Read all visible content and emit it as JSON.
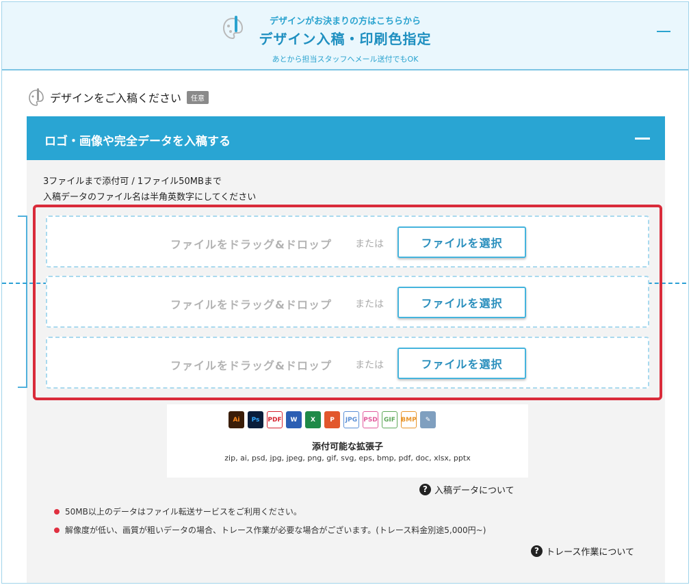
{
  "header": {
    "subtitle": "デザインがお決まりの方はこちらから",
    "title": "デザイン入稿・印刷色指定",
    "note": "あとから担当スタッフへメール送付でもOK",
    "icon": "palette-icon"
  },
  "section": {
    "title": "デザインをご入稿ください",
    "badge": "任意"
  },
  "panel": {
    "title": "ロゴ・画像や完全データを入稿する",
    "info_line1": "3ファイルまで添付可 / 1ファイル50MBまで",
    "info_line2": "入稿データのファイル名は半角英数字にしてください"
  },
  "dropzones": [
    {
      "drop_text": "ファイルをドラッグ&ドロップ",
      "or_text": "または",
      "button": "ファイルを選択"
    },
    {
      "drop_text": "ファイルをドラッグ&ドロップ",
      "or_text": "または",
      "button": "ファイルを選択"
    },
    {
      "drop_text": "ファイルをドラッグ&ドロップ",
      "or_text": "または",
      "button": "ファイルを選択"
    }
  ],
  "extensions": {
    "icons": [
      {
        "label": "Ai",
        "color": "#3a1d08",
        "fg": "#ff8a1d"
      },
      {
        "label": "Ps",
        "color": "#0a1d3a",
        "fg": "#34a8ff"
      },
      {
        "label": "PDF",
        "color": "#ffffff",
        "fg": "#d6242f"
      },
      {
        "label": "W",
        "color": "#2b5eb3",
        "fg": "#ffffff"
      },
      {
        "label": "X",
        "color": "#1f8a48",
        "fg": "#ffffff"
      },
      {
        "label": "P",
        "color": "#e2572c",
        "fg": "#ffffff"
      },
      {
        "label": "JPG",
        "color": "#ffffff",
        "fg": "#5a8fd6"
      },
      {
        "label": "PSD",
        "color": "#ffffff",
        "fg": "#e25a9c"
      },
      {
        "label": "GIF",
        "color": "#ffffff",
        "fg": "#5fa85a"
      },
      {
        "label": "BMP",
        "color": "#ffffff",
        "fg": "#e9952a"
      },
      {
        "label": "✎",
        "color": "#7f9fbf",
        "fg": "#ffffff"
      }
    ],
    "title": "添付可能な拡張子",
    "list": "zip, ai, psd, jpg, jpeg, png, gif, svg, eps, bmp, pdf, doc, xlsx, pptx"
  },
  "links": {
    "about_data": "入稿データについて",
    "about_trace": "トレース作業について"
  },
  "notes": [
    "50MB以上のデータはファイル転送サービスをご利用ください。",
    "解像度が低い、画質が粗いデータの場合、トレース作業が必要な場合がございます。(トレース料金別途5,000円~)"
  ],
  "colors": {
    "accent": "#29a5d3",
    "highlight": "#d92b3a"
  }
}
